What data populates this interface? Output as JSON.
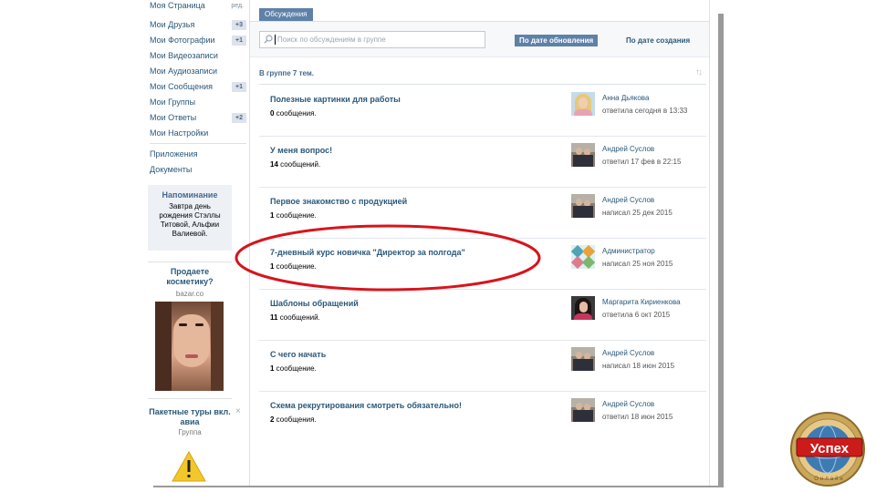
{
  "left_menu": {
    "items": [
      {
        "label": "Моя Страница",
        "badge": "ред."
      },
      {
        "label": "Мои Друзья",
        "badge": "+3"
      },
      {
        "label": "Мои Фотографии",
        "badge": "+1"
      },
      {
        "label": "Мои Видеозаписи",
        "badge": ""
      },
      {
        "label": "Мои Аудиозаписи",
        "badge": ""
      },
      {
        "label": "Мои Сообщения",
        "badge": "+1"
      },
      {
        "label": "Мои Группы",
        "badge": ""
      },
      {
        "label": "Мои Ответы",
        "badge": "+2"
      },
      {
        "label": "Мои Настройки",
        "badge": ""
      }
    ],
    "extra_items": [
      "Приложения",
      "Документы"
    ],
    "reminder": {
      "title": "Напоминание",
      "text": "Завтра день рождения Стэллы Титовой, Альфии Валиевой."
    },
    "ad1": {
      "title": "Продаете косметику?",
      "sub": "bazar.co"
    },
    "ad2": {
      "title": "Пакетные туры вкл. авиа",
      "sub": "Группа",
      "close": "×"
    }
  },
  "tabs": {
    "discussions": "Обсуждения"
  },
  "search": {
    "placeholder": "Поиск по обсуждениям в группе"
  },
  "sort": {
    "by_updated": "По дате обновления",
    "by_created": "По дате создания",
    "arrows": "↑↓"
  },
  "group_count": "В группе 7 тем.",
  "topics": [
    {
      "title": "Полезные картинки для работы",
      "count": "0",
      "count_suffix": " сообщения.",
      "author": "Анна Дьякова",
      "time": "ответила сегодня в 13:33",
      "avatar": "anna"
    },
    {
      "title": "У меня вопрос!",
      "count": "14",
      "count_suffix": " сообщений.",
      "author": "Андрей Суслов",
      "time": "ответил 17 фев в 22:15",
      "avatar": "andrey"
    },
    {
      "title": "Первое знакомство с продукцией",
      "count": "1",
      "count_suffix": " сообщение.",
      "author": "Андрей Суслов",
      "time": "написал 25 дек 2015",
      "avatar": "andrey"
    },
    {
      "title": "7-дневный курс новичка \"Директор за полгода\"",
      "count": "1",
      "count_suffix": " сообщение.",
      "author": "Администратор",
      "time": "написал 25 ноя 2015",
      "avatar": "admin"
    },
    {
      "title": "Шаблоны обращений",
      "count": "11",
      "count_suffix": " сообщений.",
      "author": "Маргарита Кириенкова",
      "time": "ответила 6 окт 2015",
      "avatar": "margo"
    },
    {
      "title": "С чего начать",
      "count": "1",
      "count_suffix": " сообщение.",
      "author": "Андрей Суслов",
      "time": "написал 18 июн 2015",
      "avatar": "andrey"
    },
    {
      "title": "Схема рекрутирования смотреть обязательно!",
      "count": "2",
      "count_suffix": " сообщения.",
      "author": "Андрей Суслов",
      "time": "ответил 18 июн 2015",
      "avatar": "andrey"
    }
  ],
  "logo": {
    "text": "Успех",
    "subtext": "Онлайн"
  },
  "colors": {
    "accent": "#5e81a8",
    "link": "#2b587a",
    "highlight": "#d8141c"
  }
}
